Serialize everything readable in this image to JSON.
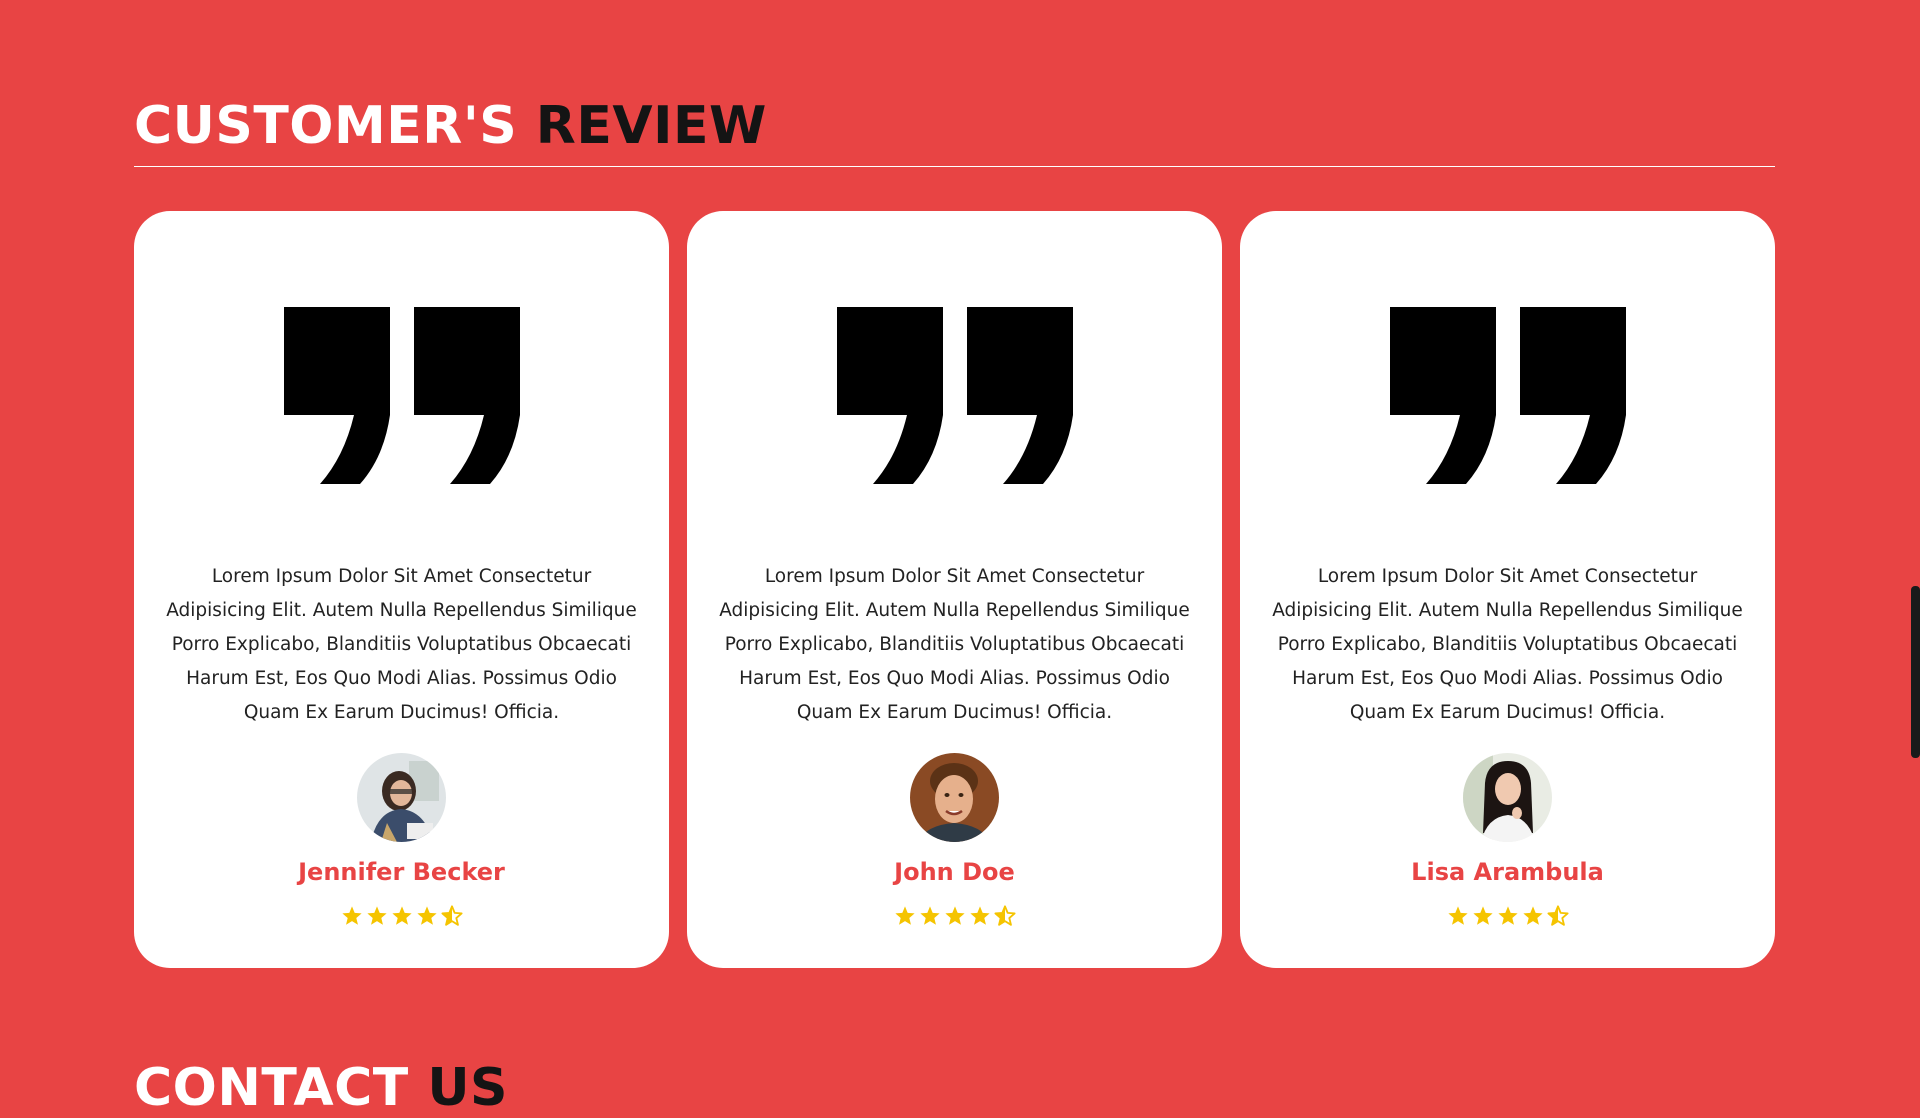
{
  "section": {
    "title_part1": "CUSTOMER'S ",
    "title_part2": "REVIEW"
  },
  "reviews": [
    {
      "text": "Lorem Ipsum Dolor Sit Amet Consectetur Adipisicing Elit. Autem Nulla Repellendus Similique Porro Explicabo, Blanditiis Voluptatibus Obcaecati Harum Est, Eos Quo Modi Alias. Possimus Odio Quam Ex Earum Ducimus! Officia.",
      "name": "Jennifer Becker",
      "rating": 4.5
    },
    {
      "text": "Lorem Ipsum Dolor Sit Amet Consectetur Adipisicing Elit. Autem Nulla Repellendus Similique Porro Explicabo, Blanditiis Voluptatibus Obcaecati Harum Est, Eos Quo Modi Alias. Possimus Odio Quam Ex Earum Ducimus! Officia.",
      "name": "John Doe",
      "rating": 4.5
    },
    {
      "text": "Lorem Ipsum Dolor Sit Amet Consectetur Adipisicing Elit. Autem Nulla Repellendus Similique Porro Explicabo, Blanditiis Voluptatibus Obcaecati Harum Est, Eos Quo Modi Alias. Possimus Odio Quam Ex Earum Ducimus! Officia.",
      "name": "Lisa Arambula",
      "rating": 4.5
    }
  ],
  "icons": {
    "quote": "quote-icon",
    "star_full": "star-icon",
    "star_half": "star-half-icon"
  },
  "next_section": {
    "title_part1": "CONTACT ",
    "title_part2": "US"
  },
  "colors": {
    "background": "#e84444",
    "card": "#ffffff",
    "accent": "#e84444",
    "star": "#f5c400",
    "title_dark": "#141414"
  }
}
